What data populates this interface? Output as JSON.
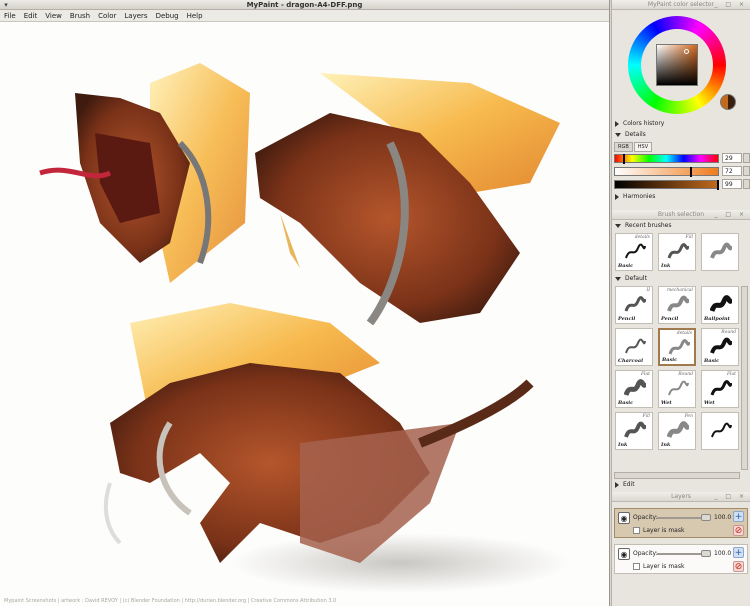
{
  "main_window": {
    "title": "MyPaint - dragon-A4-DFF.png",
    "menu": [
      "File",
      "Edit",
      "View",
      "Brush",
      "Color",
      "Layers",
      "Debug",
      "Help"
    ],
    "footer_text": "Mypaint Screenshots | artwork : David REVOY | (c) Blender Foundation | http://durian.blender.org | Creative Commons Attribution 3.0"
  },
  "color_panel": {
    "title": "MyPaint color selector",
    "colors_history_label": "Colors history",
    "details_label": "Details",
    "tabs": [
      "RGB",
      "HSV"
    ],
    "active_tab": "HSV",
    "h_value": "29",
    "s_value": "72",
    "v_value": "99",
    "harmonies_label": "Harmonies",
    "current_color": "#c26a1c",
    "previous_color": "#3a1f10"
  },
  "brush_panel": {
    "title": "Brush selection",
    "recent_label": "Recent brushes",
    "default_label": "Default",
    "edit_label": "Edit",
    "recent": [
      {
        "label": "Basic",
        "name": "details"
      },
      {
        "label": "Ink",
        "name": "Fill"
      },
      {
        "label": "",
        "name": ""
      }
    ],
    "default": [
      {
        "label": "Pencil",
        "name": "II"
      },
      {
        "label": "Pencil",
        "name": "mechanical"
      },
      {
        "label": "Ballpoint",
        "name": ""
      },
      {
        "label": "Charcoal",
        "name": ""
      },
      {
        "label": "Basic",
        "name": "details"
      },
      {
        "label": "Basic",
        "name": "Round"
      },
      {
        "label": "Basic",
        "name": "Flat"
      },
      {
        "label": "Wet",
        "name": "Round"
      },
      {
        "label": "Wet",
        "name": "Flat"
      },
      {
        "label": "Ink",
        "name": "Fill"
      },
      {
        "label": "Ink",
        "name": "Pen"
      },
      {
        "label": "",
        "name": ""
      }
    ]
  },
  "layers_panel": {
    "title": "Layers",
    "opacity_label": "Opacity:",
    "mask_label": "Layer is mask",
    "layers": [
      {
        "opacity": "100.0",
        "selected": true
      },
      {
        "opacity": "100.0",
        "selected": false
      }
    ]
  }
}
